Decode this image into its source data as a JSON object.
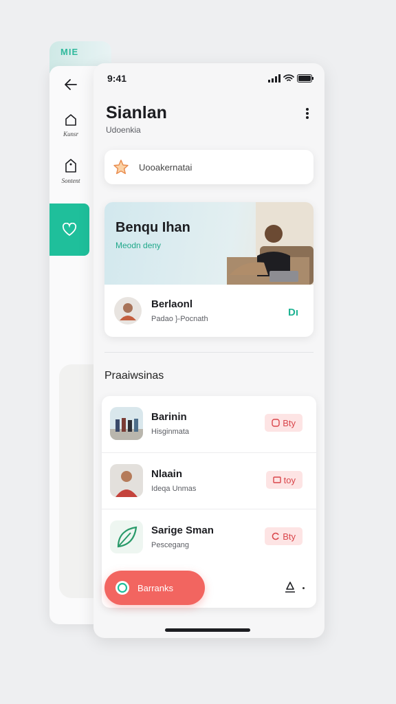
{
  "back_panel": {
    "peek_text": "MIE",
    "nav": [
      {
        "label": "Kunsr",
        "icon": "home-icon"
      },
      {
        "label": "Sontent",
        "icon": "tag-icon"
      },
      {
        "label": "",
        "icon": "heart-icon"
      }
    ]
  },
  "status_bar": {
    "time": "9:41"
  },
  "header": {
    "title": "Sianlan",
    "subtitle": "Udoenkia"
  },
  "search": {
    "placeholder": "Uooakernatai"
  },
  "hero": {
    "title": "Benqu Ihan",
    "subtitle": "Meodn deny",
    "profile_name": "Berlaonl",
    "profile_sub": "Padao }-Pocnath",
    "action": "Dı"
  },
  "section_title": "Praaiwsinas",
  "list": [
    {
      "title": "Barinin",
      "sub": "Hisginmata",
      "pill": "Bty",
      "thumb": "group-photo"
    },
    {
      "title": "Nlaain",
      "sub": "Ideqa Unmas",
      "pill": "toy",
      "thumb": "person-photo"
    },
    {
      "title": "Sarige Sman",
      "sub": "Pescegang",
      "pill": "Bty",
      "thumb": "leaf-logo"
    }
  ],
  "fab": {
    "label": "Barranks"
  },
  "colors": {
    "accent": "#1fbf9b",
    "danger": "#f26560",
    "pill_bg": "#fde4e4"
  }
}
